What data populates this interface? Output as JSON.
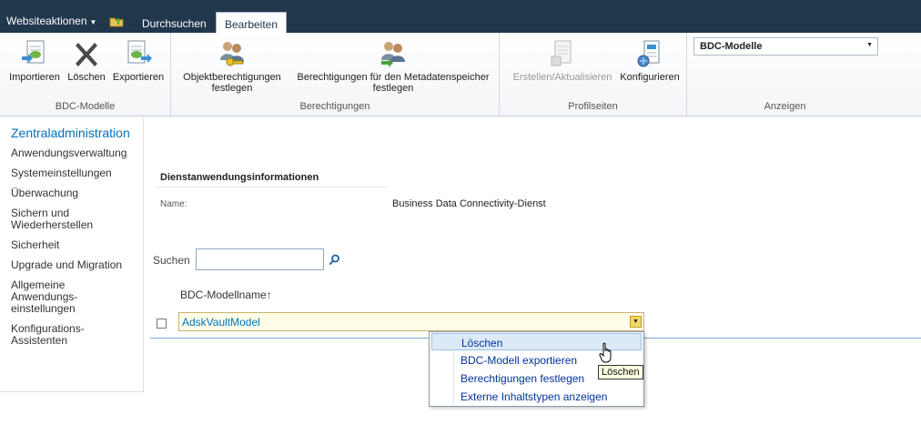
{
  "topbar": {
    "site_actions": "Websiteaktionen",
    "tabs": [
      {
        "label": "Durchsuchen"
      },
      {
        "label": "Bearbeiten"
      }
    ]
  },
  "ribbon": {
    "groups": [
      {
        "label": "BDC-Modelle",
        "buttons": [
          {
            "label": "Importieren"
          },
          {
            "label": "Löschen"
          },
          {
            "label": "Exportieren"
          }
        ]
      },
      {
        "label": "Berechtigungen",
        "buttons": [
          {
            "line1": "Objektberechtigungen",
            "line2": "festlegen"
          },
          {
            "line1": "Berechtigungen für den Metadatenspeicher",
            "line2": "festlegen"
          }
        ]
      },
      {
        "label": "Profilseiten",
        "buttons": [
          {
            "label": "Erstellen/Aktualisieren"
          },
          {
            "label": "Konfigurieren"
          }
        ]
      },
      {
        "label": "Anzeigen",
        "select_value": "BDC-Modelle"
      }
    ]
  },
  "leftnav": {
    "heading": "Zentraladministration",
    "items": [
      {
        "line1": "Anwendungsverwaltung"
      },
      {
        "line1": "Systemeinstellungen"
      },
      {
        "line1": "Überwachung"
      },
      {
        "line1": "Sichern und",
        "line2": "Wiederherstellen"
      },
      {
        "line1": "Sicherheit"
      },
      {
        "line1": "Upgrade und Migration"
      },
      {
        "line1": "Allgemeine",
        "line2": "Anwendungs-",
        "line3": "einstellungen"
      },
      {
        "line1": "Konfigurations-",
        "line2": "Assistenten"
      }
    ]
  },
  "main": {
    "section_title": "Dienstanwendungsinformationen",
    "name_label": "Name:",
    "name_value": "Business Data Connectivity-Dienst",
    "search_label": "Suchen",
    "search_value": "",
    "column_header": "BDC-Modellname",
    "sort_indicator": "↑",
    "rows": [
      {
        "name": "AdskVaultModel"
      }
    ]
  },
  "context_menu": {
    "items": [
      {
        "label": "Löschen"
      },
      {
        "label": "BDC-Modell exportieren"
      },
      {
        "label": "Berechtigungen festlegen"
      },
      {
        "label": "Externe Inhaltstypen anzeigen"
      }
    ],
    "tooltip": "Löschen"
  },
  "colors": {
    "topbar": "#21374c",
    "link": "#0072bc",
    "menu_hover": "#dce9f7"
  }
}
